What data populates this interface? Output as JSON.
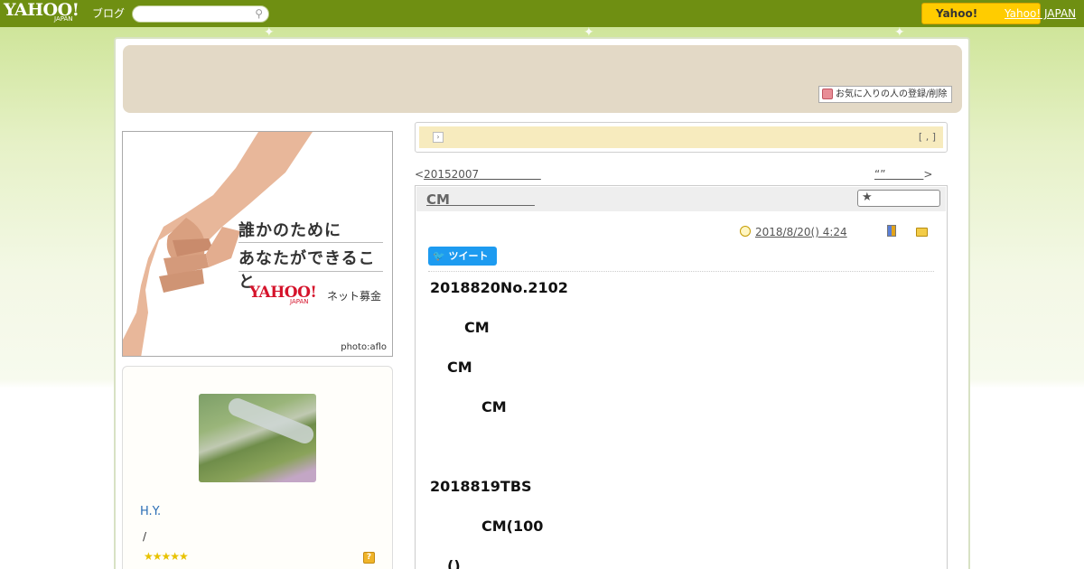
{
  "topbar": {
    "logo": "YAHOO!",
    "logo_sub": "JAPAN",
    "logo_blog": "ブログ",
    "search_placeholder": "",
    "yahoo_button": "Yahoo!",
    "yahoo_link": "Yahoo! JAPAN"
  },
  "header": {
    "fav_button": "お気に入りの人の登録/削除"
  },
  "banner": {
    "line1": "誰かのために",
    "line2": "あなたができること",
    "logo": "YAHOO!",
    "logo_sub": "JAPAN",
    "service": "ネット募金",
    "credit": "photo:aflo"
  },
  "profile": {
    "name": "H.Y.",
    "slash": "/",
    "stars": "★★★★★",
    "help": "?"
  },
  "notice": {
    "text": "[ , ]"
  },
  "nav": {
    "prev_arrow": "<",
    "prev_link": "20152007",
    "next_link": "“”",
    "next_arrow": ">"
  },
  "article": {
    "title": "CM",
    "date": "2018/8/20()  4:24",
    "tweet": "ツイート",
    "lines": [
      "2018820No.2102",
      "CM",
      "CM",
      "CM",
      "2018819TBS",
      "CM(100",
      "()"
    ]
  },
  "colors": {
    "topbar": "#6f8f12",
    "header": "#e3d9c6",
    "notice": "#f7ebbe",
    "tweet": "#1d9bf0",
    "link": "#2a6db5"
  }
}
